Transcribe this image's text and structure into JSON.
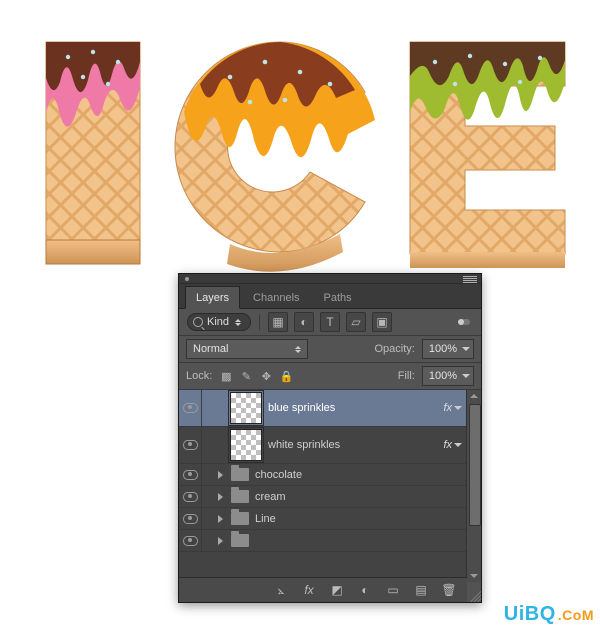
{
  "artwork": {
    "display_text": "ICE"
  },
  "panel": {
    "tabs": [
      {
        "label": "Layers",
        "active": true
      },
      {
        "label": "Channels",
        "active": false
      },
      {
        "label": "Paths",
        "active": false
      }
    ],
    "filter": {
      "kind_label": "Kind",
      "icons": [
        "pixel-layer",
        "adjustment-layer",
        "type-layer",
        "shape-layer",
        "smart-object"
      ]
    },
    "blend_mode": "Normal",
    "opacity_label": "Opacity:",
    "opacity_value": "100%",
    "lock_label": "Lock:",
    "fill_label": "Fill:",
    "fill_value": "100%",
    "layers": [
      {
        "name": "blue sprinkles",
        "kind": "layer",
        "selected": true,
        "visible": true,
        "has_fx": true,
        "indent": 24
      },
      {
        "name": "white sprinkles",
        "kind": "layer",
        "selected": false,
        "visible": true,
        "has_fx": true,
        "indent": 24
      },
      {
        "name": "chocolate",
        "kind": "folder",
        "selected": false,
        "visible": true,
        "has_fx": false,
        "indent": 12
      },
      {
        "name": "cream",
        "kind": "folder",
        "selected": false,
        "visible": true,
        "has_fx": false,
        "indent": 12
      },
      {
        "name": "Line",
        "kind": "folder",
        "selected": false,
        "visible": true,
        "has_fx": false,
        "indent": 12
      },
      {
        "name": "",
        "kind": "folder",
        "selected": false,
        "visible": true,
        "has_fx": false,
        "indent": 12
      }
    ],
    "fx_label": "fx",
    "bottom_icons": [
      "link-layers",
      "layer-style",
      "layer-mask",
      "adjustment-layer",
      "group",
      "new-layer",
      "delete-layer"
    ]
  },
  "watermark": {
    "brand": "UiBQ",
    "suffix": ".CoM"
  },
  "colors": {
    "panel_bg": "#535353",
    "panel_dark": "#3a3a3a",
    "selection": "#6a7a94",
    "watermark_blue": "#2fb4e6",
    "watermark_orange": "#f29a18"
  }
}
